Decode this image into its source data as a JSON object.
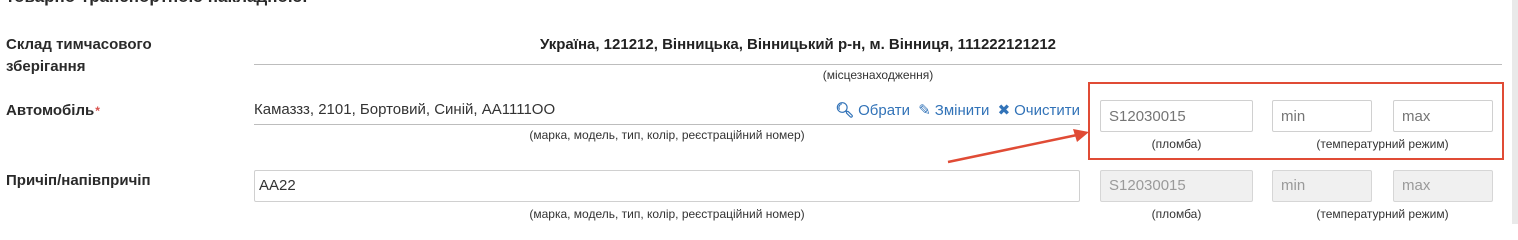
{
  "header": {
    "cut_text": "товарно-транспортною накладною."
  },
  "storage": {
    "label_line1": "Склад тимчасового",
    "label_line2": "зберігання",
    "value": "Україна, 121212, Вінницька, Вінницький р-н, м. Вінниця, 111222121212",
    "caption": "(місцезнаходження)"
  },
  "vehicle": {
    "label": "Автомобіль",
    "required_mark": "*",
    "value": "Камаззз, 2101, Бортовий, Синій, АА1111ОО",
    "caption": "(марка, модель, тип, колір, реєстраційний номер)",
    "actions": {
      "select": "Обрати",
      "edit": "Змінити",
      "clear": "Очистити"
    },
    "seal_placeholder": "S12030015",
    "seal_caption": "(пломба)",
    "temp_min_placeholder": "min",
    "temp_max_placeholder": "max",
    "temp_caption": "(температурний режим)"
  },
  "trailer": {
    "label": "Причіп/напівпричіп",
    "value": "AA22",
    "caption": "(марка, модель, тип, колір, реєстраційний номер)",
    "seal_value": "S12030015",
    "seal_caption": "(пломба)",
    "temp_min_value": "min",
    "temp_max_value": "max",
    "temp_caption": "(температурний режим)"
  },
  "colors": {
    "accent": "#e04b35",
    "link": "#3273b8"
  },
  "icons": {
    "select": "search-icon",
    "edit": "edit-icon",
    "clear": "close-icon"
  }
}
